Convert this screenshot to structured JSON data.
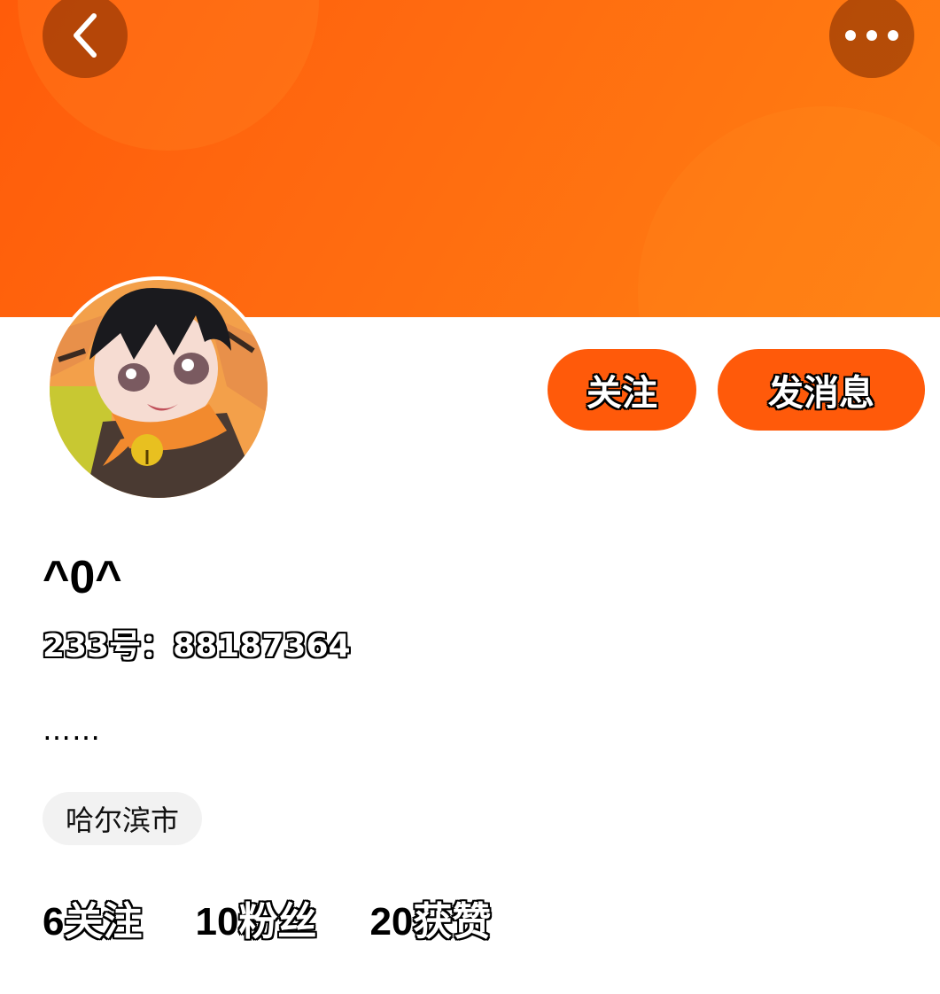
{
  "header": {
    "back_icon": "chevron-left-icon",
    "more_icon": "more-horizontal-icon"
  },
  "colors": {
    "brand": "#ff5a0a",
    "banner_start": "#ff5c0a",
    "banner_end": "#ff8012",
    "tag_bg": "#f2f2f2"
  },
  "actions": {
    "follow_label": "关注",
    "message_label": "发消息"
  },
  "profile": {
    "username": "^0^",
    "user_id": "233号：88187364",
    "bio": "……",
    "location": "哈尔滨市"
  },
  "stats": [
    {
      "count": "6",
      "label": "关注"
    },
    {
      "count": "10",
      "label": "粉丝"
    },
    {
      "count": "20",
      "label": "获赞"
    }
  ]
}
